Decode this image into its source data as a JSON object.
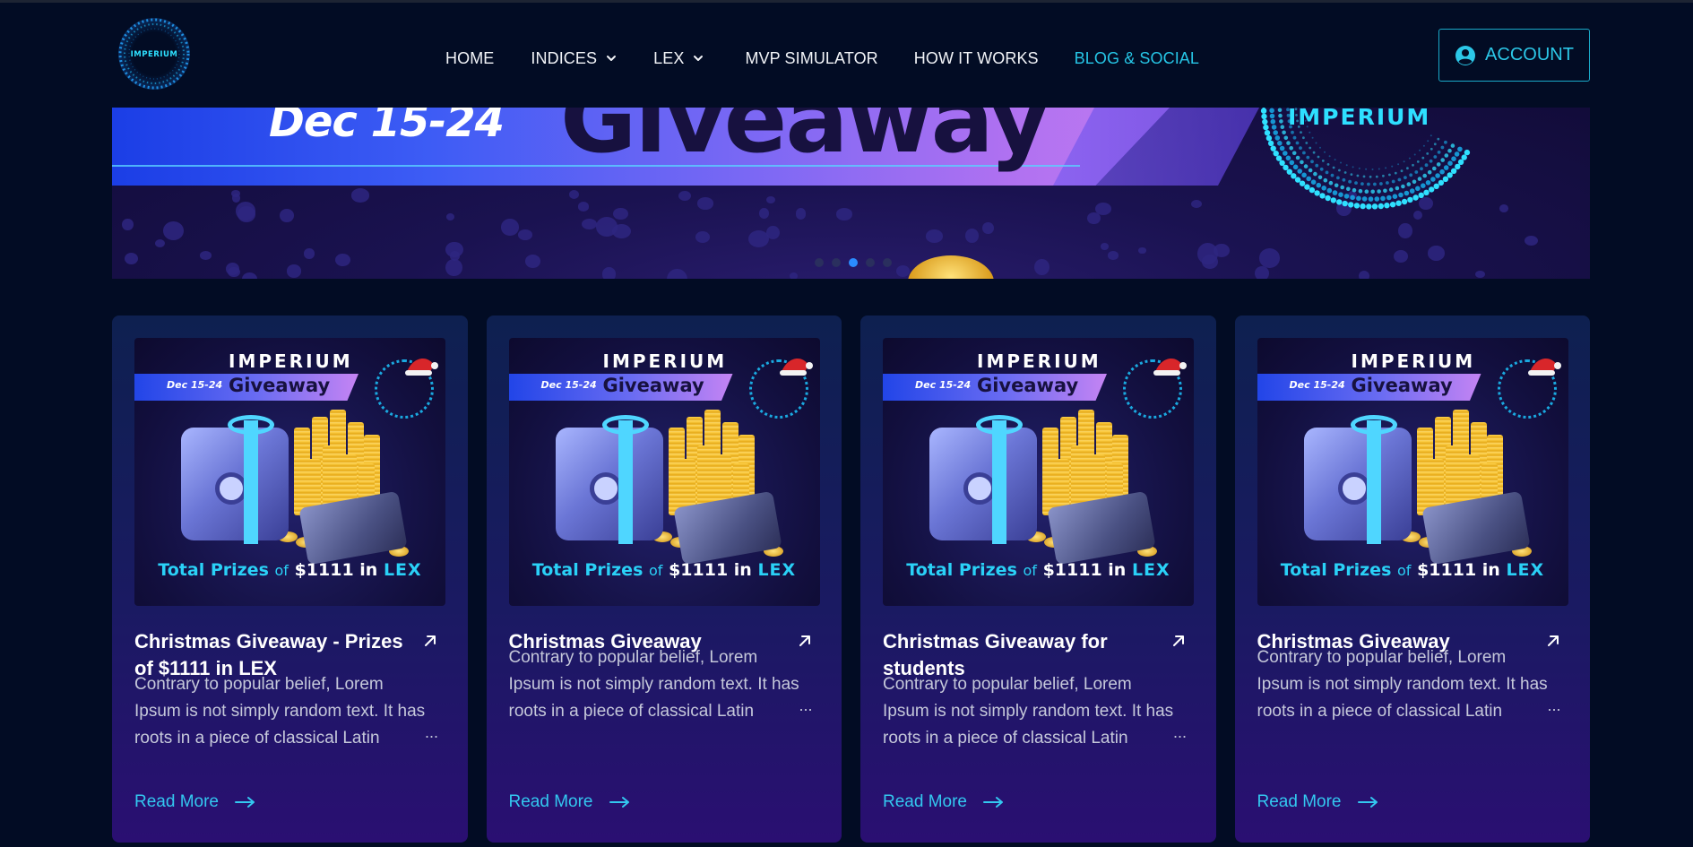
{
  "header": {
    "logo_text": "IMPERIUM",
    "nav": [
      {
        "label": "HOME",
        "has_dropdown": false,
        "active": false
      },
      {
        "label": "INDICES",
        "has_dropdown": true,
        "active": false
      },
      {
        "label": "LEX",
        "has_dropdown": true,
        "active": false
      },
      {
        "label": "MVP SIMULATOR",
        "has_dropdown": false,
        "active": false
      },
      {
        "label": "HOW IT WORKS",
        "has_dropdown": false,
        "active": false
      },
      {
        "label": "BLOG & SOCIAL",
        "has_dropdown": false,
        "active": true
      }
    ],
    "account_label": "ACCOUNT",
    "account_icon": "user-circle-icon"
  },
  "banner": {
    "date": "Dec 15-24",
    "title": "Giveaway",
    "brand": "IMPERIUM",
    "slides": 5,
    "active_slide": 3
  },
  "cards": [
    {
      "image": {
        "brand": "IMPERIUM",
        "date": "Dec 15-24",
        "title": "Giveaway",
        "prize_label": "Total Prizes",
        "prize_of": "of",
        "prize_amount": "$1111 in",
        "prize_token": "LEX"
      },
      "title": "Christmas Giveaway - Prizes of $1111 in LEX",
      "excerpt": "Contrary to popular belief, Lorem Ipsum is not simply random text. It has roots in a piece of classical Latin",
      "ellipsis": "...",
      "read_more": "Read More"
    },
    {
      "image": {
        "brand": "IMPERIUM",
        "date": "Dec 15-24",
        "title": "Giveaway",
        "prize_label": "Total Prizes",
        "prize_of": "of",
        "prize_amount": "$1111 in",
        "prize_token": "LEX"
      },
      "title": "Christmas Giveaway",
      "excerpt": "Contrary to popular belief, Lorem Ipsum is not simply random text. It has roots in a piece of classical Latin",
      "ellipsis": "...",
      "read_more": "Read More"
    },
    {
      "image": {
        "brand": "IMPERIUM",
        "date": "Dec 15-24",
        "title": "Giveaway",
        "prize_label": "Total Prizes",
        "prize_of": "of",
        "prize_amount": "$1111 in",
        "prize_token": "LEX"
      },
      "title": "Christmas Giveaway for students",
      "excerpt": "Contrary to popular belief, Lorem Ipsum is not simply random text. It has roots in a piece of classical Latin",
      "ellipsis": "...",
      "read_more": "Read More"
    },
    {
      "image": {
        "brand": "IMPERIUM",
        "date": "Dec 15-24",
        "title": "Giveaway",
        "prize_label": "Total Prizes",
        "prize_of": "of",
        "prize_amount": "$1111 in",
        "prize_token": "LEX"
      },
      "title": "Christmas Giveaway",
      "excerpt": "Contrary to popular belief, Lorem Ipsum is not simply random text. It has roots in a piece of classical Latin",
      "ellipsis": "...",
      "read_more": "Read More"
    }
  ],
  "colors": {
    "background": "#020c24",
    "accent": "#26c6e6",
    "card_top": "#0e2050",
    "card_bottom": "#2a0f72"
  }
}
